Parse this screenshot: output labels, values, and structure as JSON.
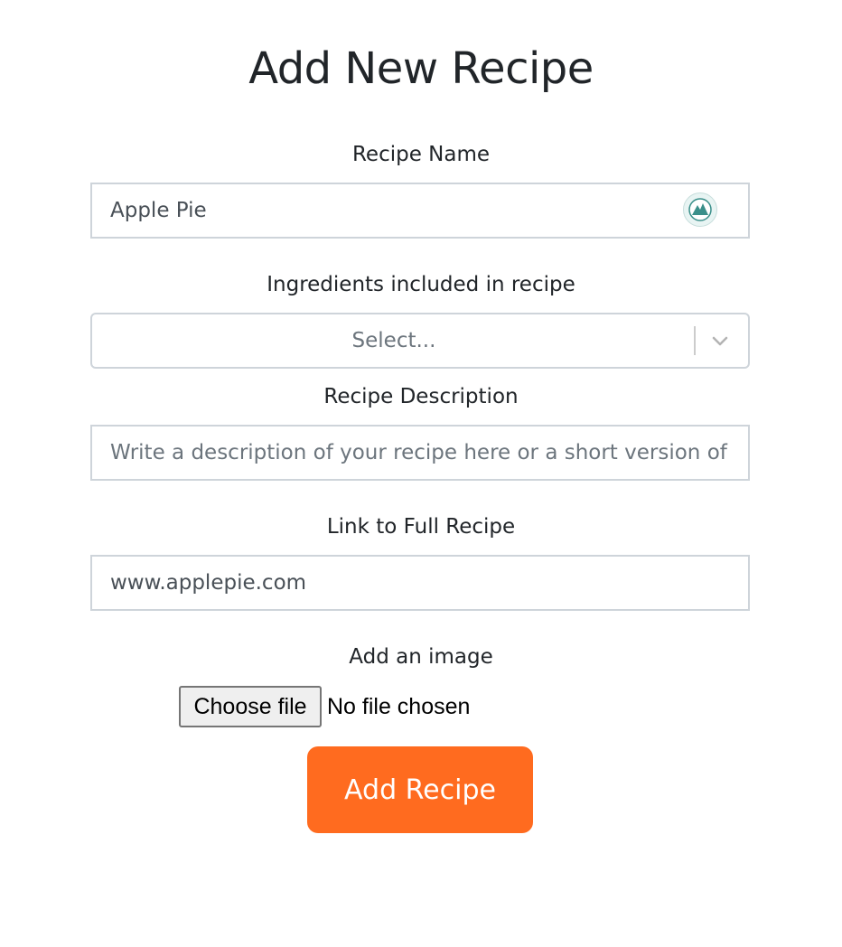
{
  "page": {
    "title": "Add New Recipe"
  },
  "form": {
    "recipe_name": {
      "label": "Recipe Name",
      "value": "Apple Pie",
      "icon": "password-manager-icon"
    },
    "ingredients": {
      "label": "Ingredients included in recipe",
      "placeholder": "Select...",
      "icon": "chevron-down-icon"
    },
    "description": {
      "label": "Recipe Description",
      "placeholder": "Write a description of your recipe here or a short version of"
    },
    "link": {
      "label": "Link to Full Recipe",
      "value": "www.applepie.com"
    },
    "image": {
      "label": "Add an image",
      "button_label": "Choose file",
      "status": "No file chosen"
    },
    "submit_label": "Add Recipe"
  },
  "colors": {
    "accent": "#ff6b1f",
    "input_border": "#ced4da",
    "icon_teal": "#3a8f8a"
  }
}
